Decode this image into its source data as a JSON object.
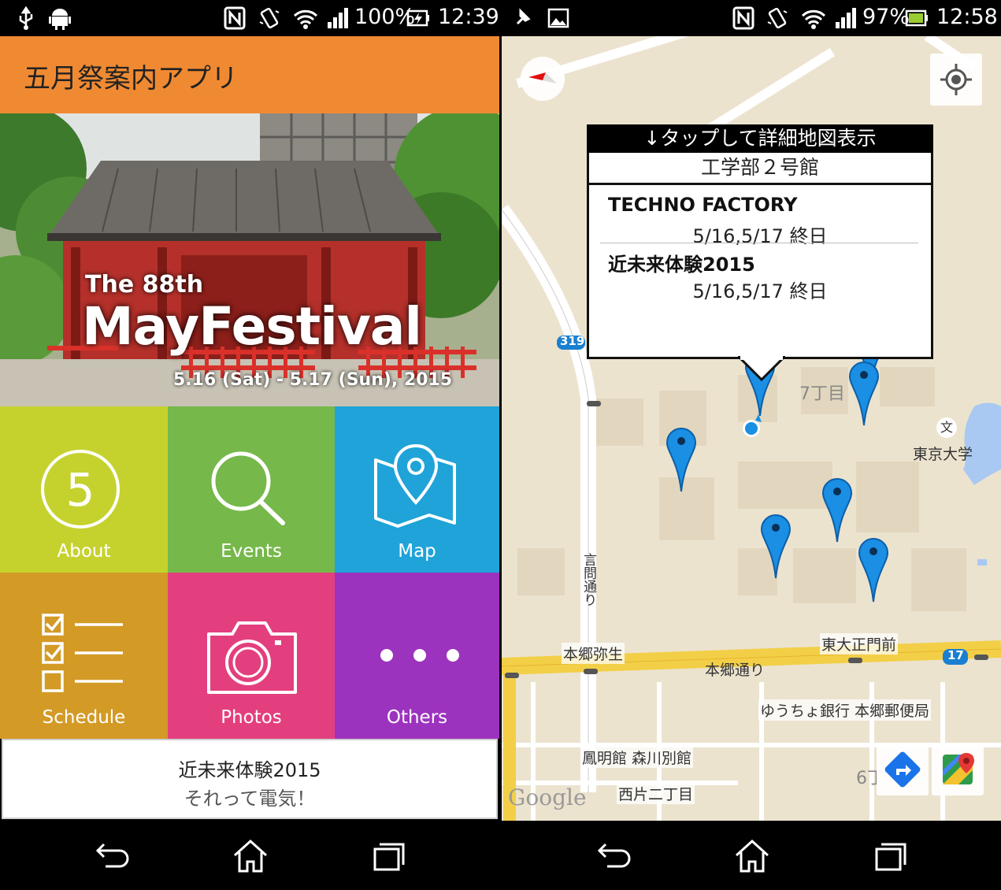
{
  "left_screen": {
    "status_bar": {
      "icons": [
        "usb-icon",
        "android-icon",
        "nfc-icon",
        "vibrate-icon",
        "wifi-icon",
        "signal-icon",
        "battery-charging-icon"
      ],
      "battery": "100%",
      "time": "12:39"
    },
    "app_title": "五月祭案内アプリ",
    "hero": {
      "line1": "The 88th",
      "line2": "MayFestival",
      "dates": "5.16 (Sat) - 5.17 (Sun), 2015"
    },
    "menu": [
      {
        "label": "About",
        "icon": "calendar-5-icon",
        "icon_text": "5",
        "color": "#c5d22e"
      },
      {
        "label": "Events",
        "icon": "search-icon",
        "color": "#76b84a"
      },
      {
        "label": "Map",
        "icon": "map-icon",
        "color": "#1fa3d8"
      },
      {
        "label": "Schedule",
        "icon": "checklist-icon",
        "color": "#d39a26"
      },
      {
        "label": "Photos",
        "icon": "camera-icon",
        "color": "#e33f7e"
      },
      {
        "label": "Others",
        "icon": "more-icon",
        "color": "#9c33be"
      }
    ],
    "news": {
      "line1": "近未来体験2015",
      "line2": "それって電気！"
    }
  },
  "right_screen": {
    "status_bar": {
      "icons": [
        "pin-notification-icon",
        "image-icon",
        "nfc-icon",
        "vibrate-icon",
        "wifi-icon",
        "signal-icon",
        "battery-icon"
      ],
      "battery": "97%",
      "time": "12:58"
    },
    "popup": {
      "header": "↓タップして詳細地図表示",
      "building": "工学部２号館",
      "events": [
        {
          "name": "TECHNO FACTORY",
          "date": "5/16,5/17 終日"
        },
        {
          "name": "近未来体験2015",
          "date": "5/16,5/17 終日"
        }
      ]
    },
    "map_labels": {
      "route319": "319",
      "route17": "17",
      "block7": "7丁目",
      "block6": "6丁",
      "univ": "東京大学",
      "univ_symbol": "文",
      "kototoi": "言問通り",
      "hongo_yayoi": "本郷弥生",
      "todai_seimon": "東大正門前",
      "hongo_dori": "本郷通り",
      "post_office": "ゆうちょ銀行 本郷郵便局",
      "houmeikan": "鳳明館 森川別館",
      "nishikata": "西片二丁目",
      "google": "Google"
    },
    "accent": "#1a8fe3"
  },
  "nav": {
    "buttons": [
      "back-icon",
      "home-icon",
      "recents-icon"
    ]
  }
}
